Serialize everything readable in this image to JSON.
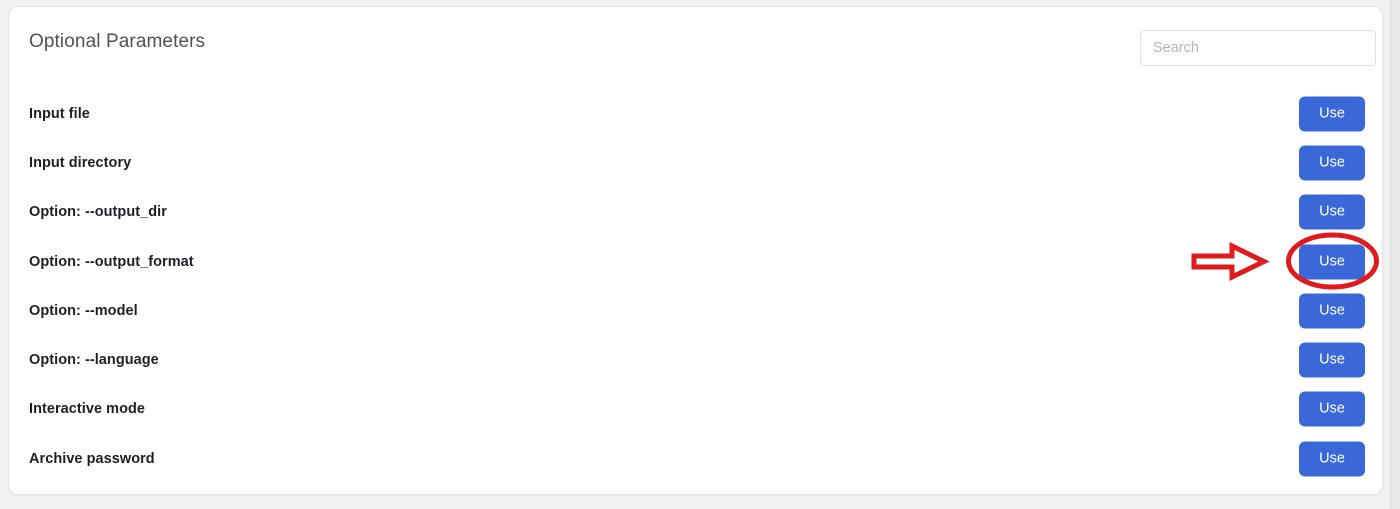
{
  "page": {
    "background_color": "#f2f2f3"
  },
  "card": {
    "title": "Optional Parameters",
    "background_color": "#ffffff"
  },
  "search": {
    "value": "",
    "placeholder": "Search"
  },
  "rows": [
    {
      "label": "Input file",
      "action_label": "Use"
    },
    {
      "label": "Input directory",
      "action_label": "Use"
    },
    {
      "label": "Option: --output_dir",
      "action_label": "Use"
    },
    {
      "label": "Option: --output_format",
      "action_label": "Use"
    },
    {
      "label": "Option: --model",
      "action_label": "Use"
    },
    {
      "label": "Option: --language",
      "action_label": "Use"
    },
    {
      "label": "Interactive mode",
      "action_label": "Use"
    },
    {
      "label": "Archive password",
      "action_label": "Use"
    }
  ],
  "annotation": {
    "color": "#e01b1b",
    "target_row_index": 3,
    "arrow_icon": "arrow-right-icon",
    "highlight_icon": "ellipse-highlight-icon"
  },
  "theme": {
    "button_color": "#3b68d8",
    "button_text_color": "#ffffff",
    "title_color": "#4f5257",
    "label_color": "#1b2028"
  }
}
